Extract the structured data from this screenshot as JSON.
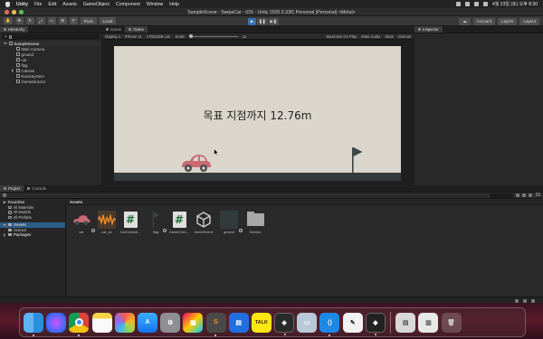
{
  "menubar": {
    "app": "Unity",
    "items": [
      "File",
      "Edit",
      "Assets",
      "GameObject",
      "Component",
      "Window",
      "Help"
    ],
    "clock": "4월 23일 (토) 오후 8:30"
  },
  "window": {
    "title": "SampleScene - SwipeCar - iOS - Unity 2020.3.33f1 Personal (Personal) <Metal>"
  },
  "toolbar": {
    "pivot": "Pivot",
    "local": "Local",
    "account": "Account",
    "layers": "Layers",
    "layout": "Layout"
  },
  "hierarchy": {
    "tab": "Hierarchy",
    "search_prefix": "+",
    "scene": "SampleScene",
    "objects": [
      "Main Camera",
      "ground",
      "car",
      "flag",
      "Canvas",
      "EventSystem",
      "GameDirector"
    ]
  },
  "game_view": {
    "tabs": {
      "scene": "Scene",
      "game": "Game"
    },
    "display": "Display 1",
    "device": "iPhone 11",
    "resolution": "1792x828 Lan",
    "scale_label": "Scale",
    "scale_value": "1x",
    "maximize": "Maximize On Play",
    "mute": "Mute Audio",
    "stats": "Stats",
    "gizmos": "Gizmos",
    "goal_text": "목표 지점까지 12.76m",
    "colors": {
      "sky": "#dad6cb",
      "ground": "#323b3b",
      "car": "#c96b74"
    }
  },
  "inspector": {
    "tab": "Inspector"
  },
  "project": {
    "tabs": {
      "project": "Project",
      "console": "Console"
    },
    "favorites": {
      "label": "Favorites",
      "items": [
        "All Materials",
        "All Models",
        "All Prefabs"
      ]
    },
    "assets_label": "Assets",
    "assets_children": [
      "Scenes"
    ],
    "packages_label": "Packages",
    "assets_header": "Assets",
    "asset_items": [
      {
        "name": "car",
        "icon": "car-sprite-icon"
      },
      {
        "name": "car_se",
        "icon": "audio-clip-icon"
      },
      {
        "name": "CarControll...",
        "icon": "csharp-script-icon"
      },
      {
        "name": "flag",
        "icon": "flag-sprite-icon"
      },
      {
        "name": "GameDirec...",
        "icon": "csharp-script-icon"
      },
      {
        "name": "GameScene",
        "icon": "unity-scene-icon"
      },
      {
        "name": "ground",
        "icon": "ground-sprite-icon"
      },
      {
        "name": "Scenes",
        "icon": "folder-icon"
      }
    ],
    "count": "15"
  },
  "dock": {
    "apps": [
      "finder-icon",
      "siri-icon",
      "chrome-icon",
      "notes-icon",
      "photos-icon",
      "app-store-icon",
      "system-preferences-icon",
      "launchpad-icon",
      "sublime-text-icon",
      "keynote-icon",
      "kakaotalk-icon",
      "unity-hub-icon",
      "preview-icon",
      "vscode-icon",
      "textedit-icon",
      "unity-icon",
      "recent-docs-icon",
      "recent-files-icon",
      "trash-icon"
    ],
    "kakao_label": "TALK"
  }
}
